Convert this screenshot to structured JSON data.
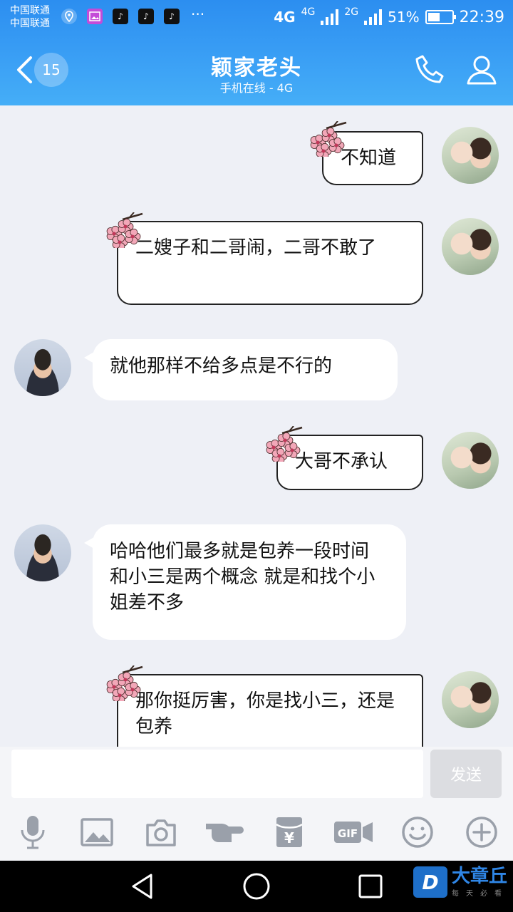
{
  "status_bar": {
    "carrier_line1": "中国联通",
    "carrier_line2": "中国联通",
    "net1": "4G",
    "net1_small": "4G",
    "net2_small": "2G",
    "battery": "51%",
    "battery_level": 0.51,
    "time": "22:39",
    "more": "···"
  },
  "header": {
    "back_count": "15",
    "title": "颖家老头",
    "subtitle": "手机在线 - 4G"
  },
  "messages": [
    {
      "side": "out",
      "text": "不知道"
    },
    {
      "side": "out",
      "text": "二嫂子和二哥闹，二哥不敢了"
    },
    {
      "side": "in",
      "text": "就他那样不给多点是不行的"
    },
    {
      "side": "out",
      "text": "大哥不承认"
    },
    {
      "side": "in",
      "text": "哈哈他们最多就是包养一段时间 和小三是两个概念 就是和找个小姐差不多"
    },
    {
      "side": "out",
      "text": "那你挺厉害，你是找小三，还是包养"
    }
  ],
  "composer": {
    "input_value": "",
    "send_label": "发送"
  },
  "toolbar": {
    "gif_label": "GIF",
    "yen_label": "¥"
  },
  "watermark": {
    "logo": "D",
    "name": "大章丘",
    "sub": "每天必看"
  },
  "colors": {
    "header_blue": "#3a9ff5",
    "background": "#eef0f6",
    "icon_gray": "#9aa0aa"
  }
}
